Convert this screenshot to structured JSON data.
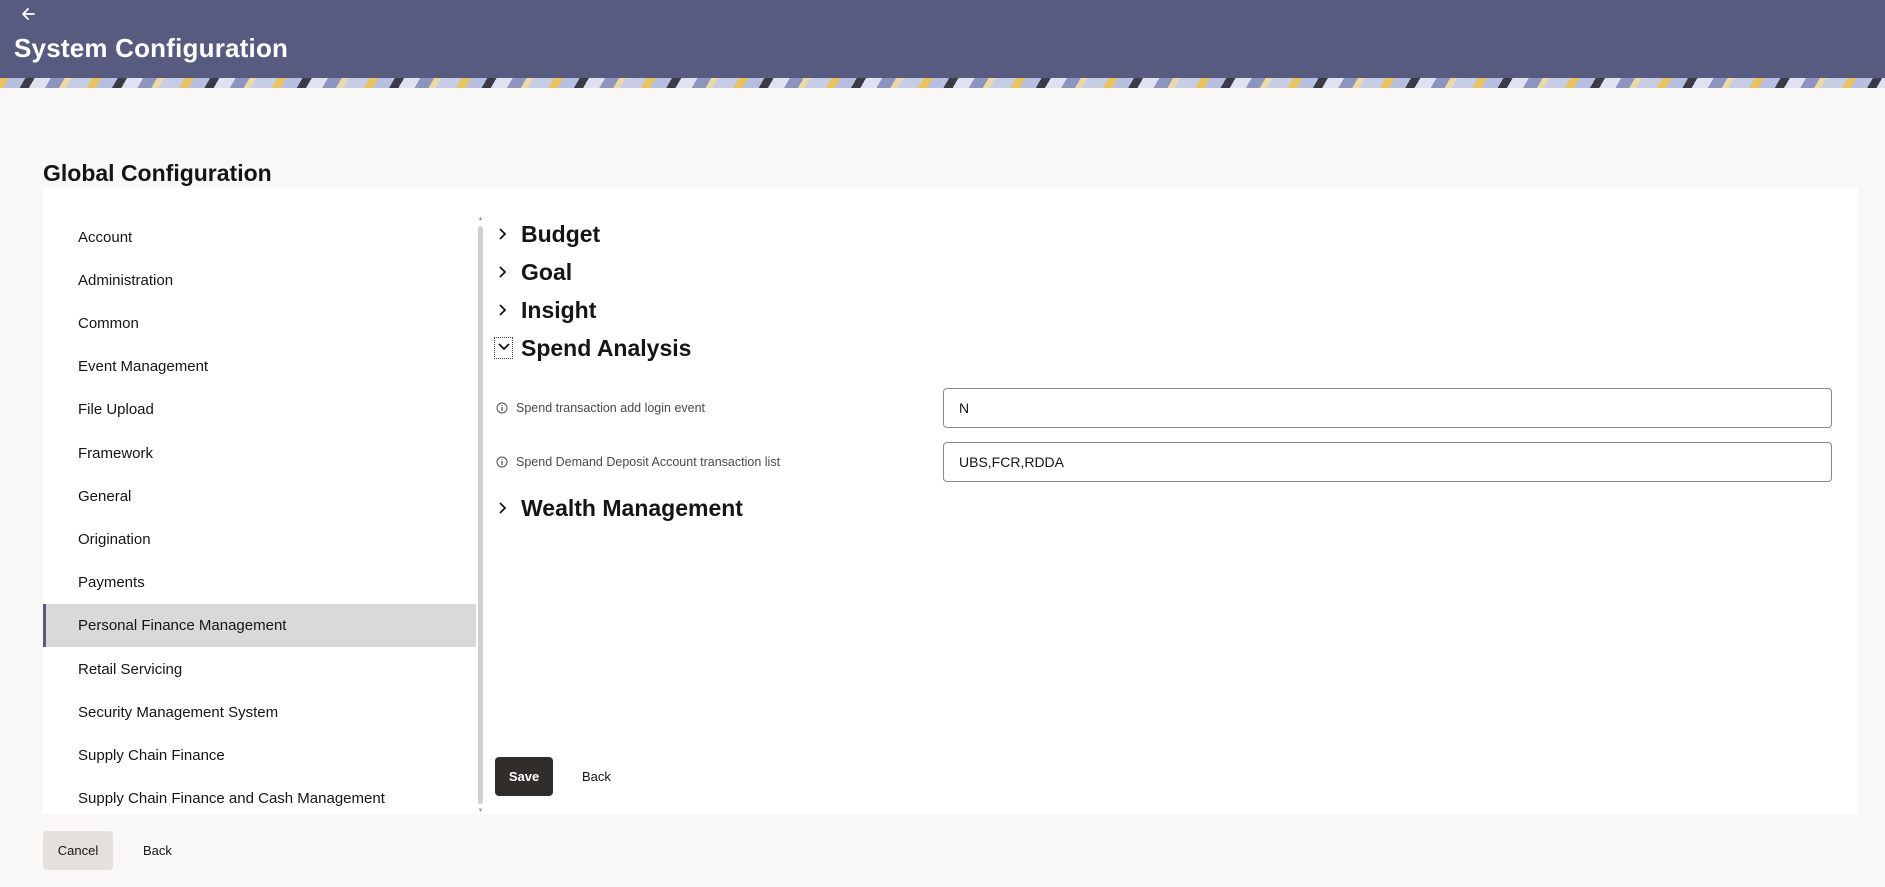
{
  "header": {
    "back_icon": "arrow-left-icon",
    "title": "System Configuration",
    "color": "#575b7f"
  },
  "section": {
    "title": "Global Configuration"
  },
  "menu": {
    "items": [
      {
        "label": "Account"
      },
      {
        "label": "Administration"
      },
      {
        "label": "Common"
      },
      {
        "label": "Event Management"
      },
      {
        "label": "File Upload"
      },
      {
        "label": "Framework"
      },
      {
        "label": "General"
      },
      {
        "label": "Origination"
      },
      {
        "label": "Payments"
      },
      {
        "label": "Personal Finance Management"
      },
      {
        "label": "Retail Servicing"
      },
      {
        "label": "Security Management System"
      },
      {
        "label": "Supply Chain Finance"
      },
      {
        "label": "Supply Chain Finance and Cash Management"
      }
    ],
    "active_item": "Personal Finance Management"
  },
  "accordion": {
    "sections": [
      {
        "label": "Budget",
        "expanded": false
      },
      {
        "label": "Goal",
        "expanded": false
      },
      {
        "label": "Insight",
        "expanded": false
      },
      {
        "label": "Spend Analysis",
        "expanded": true
      },
      {
        "label": "Wealth Management",
        "expanded": false
      }
    ],
    "fields": [
      {
        "label": "Spend transaction add login event",
        "value": "N"
      },
      {
        "label": "Spend Demand Deposit Account transaction list",
        "value": "UBS,FCR,RDDA"
      }
    ]
  },
  "actions": {
    "save_label": "Save",
    "back_label": "Back",
    "cancel_label": "Cancel",
    "bottom_back_label": "Back"
  }
}
